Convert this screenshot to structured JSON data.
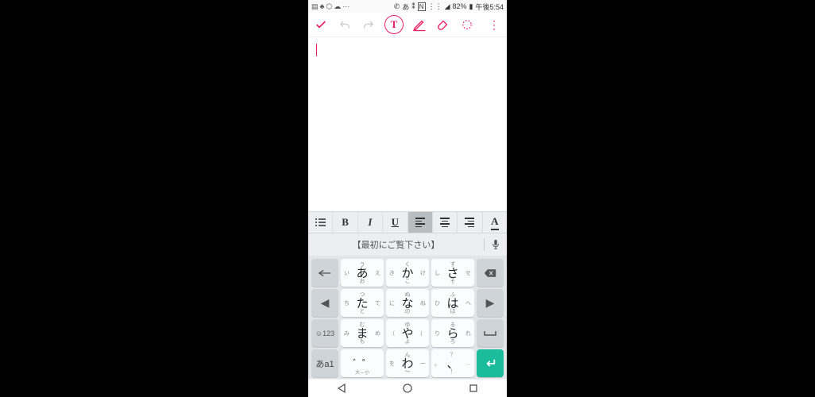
{
  "status": {
    "ime": "あ",
    "battery": "82%",
    "time": "午後5:54"
  },
  "toolbar": {
    "text_tool": "T"
  },
  "format": {
    "bold": "B",
    "italic": "I",
    "underline": "U",
    "textcolor": "A"
  },
  "suggestion": {
    "text": "【最初にご覧下さい】"
  },
  "keys": {
    "r1": [
      {
        "c": "あ",
        "t": "う",
        "b": "お",
        "l": "い",
        "r": "え"
      },
      {
        "c": "か",
        "t": "く",
        "b": "こ",
        "l": "き",
        "r": "け"
      },
      {
        "c": "さ",
        "t": "す",
        "b": "そ",
        "l": "し",
        "r": "せ"
      }
    ],
    "r2": [
      {
        "c": "た",
        "t": "つ",
        "b": "と",
        "l": "ち",
        "r": "て"
      },
      {
        "c": "な",
        "t": "ぬ",
        "b": "の",
        "l": "に",
        "r": "ね"
      },
      {
        "c": "は",
        "t": "ふ",
        "b": "ほ",
        "l": "ひ",
        "r": "へ"
      }
    ],
    "r3": [
      {
        "c": "ま",
        "t": "む",
        "b": "も",
        "l": "み",
        "r": "め"
      },
      {
        "c": "や",
        "t": "ゆ",
        "b": "よ",
        "l": "（",
        "r": "）"
      },
      {
        "c": "ら",
        "t": "る",
        "b": "ろ",
        "l": "り",
        "r": "れ"
      }
    ],
    "r4": [
      {
        "c": "゛゜",
        "sub": "大⇔小"
      },
      {
        "c": "わ",
        "t": "ん",
        "b": "〜",
        "l": "を",
        "r": "ー"
      },
      {
        "c": "、",
        "t": "？",
        "b": "！",
        "l": "。",
        "r": "…"
      }
    ],
    "side": {
      "emoji123": "☺123",
      "mode": "あa1"
    }
  }
}
